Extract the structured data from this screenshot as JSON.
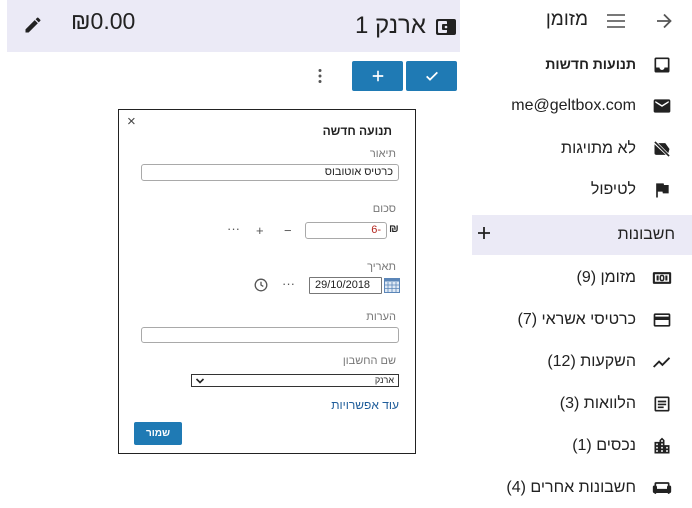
{
  "header": {
    "balance": "₪0.00",
    "wallet_title": "ארנק 1"
  },
  "dialog": {
    "close_glyph": "×",
    "title": "תנועה חדשה",
    "description_label": "תיאור",
    "description_value": "כרטיס אוטובוס",
    "amount_label": "סכום",
    "currency_symbol": "₪",
    "amount_value": "-6",
    "amount_minus": "−",
    "amount_plus": "+",
    "amount_more": "···",
    "date_label": "תאריך",
    "date_value": "29/10/2018",
    "date_more": "···",
    "notes_label": "הערות",
    "notes_value": "",
    "account_label": "שם החשבון",
    "account_selected": "ארנק",
    "more_options": "עוד אפשרויות",
    "save_label": "שמור"
  },
  "sidebar": {
    "top_title": "מזומן",
    "items": [
      {
        "label": "תנועות חדשות",
        "icon": "inbox-icon",
        "bold": true
      },
      {
        "label": "me@geltbox.com",
        "icon": "mail-icon"
      },
      {
        "label": "לא מתויגות",
        "icon": "label-off-icon"
      },
      {
        "label": "לטיפול",
        "icon": "flag-icon"
      }
    ],
    "accounts_header": "חשבונות",
    "accounts": [
      {
        "label": "מזומן (9)",
        "icon": "cash-icon"
      },
      {
        "label": "כרטיסי אשראי (7)",
        "icon": "credit-card-icon"
      },
      {
        "label": "השקעות (12)",
        "icon": "trending-up-icon"
      },
      {
        "label": "הלוואות (3)",
        "icon": "loan-icon"
      },
      {
        "label": "נכסים (1)",
        "icon": "building-icon"
      },
      {
        "label": "חשבונות אחרים (4)",
        "icon": "couch-icon"
      }
    ]
  },
  "colors": {
    "accent": "#1f7ab4",
    "header_bg": "#ebeaf6",
    "negative": "#b3261e",
    "link": "#1f5d9a"
  }
}
